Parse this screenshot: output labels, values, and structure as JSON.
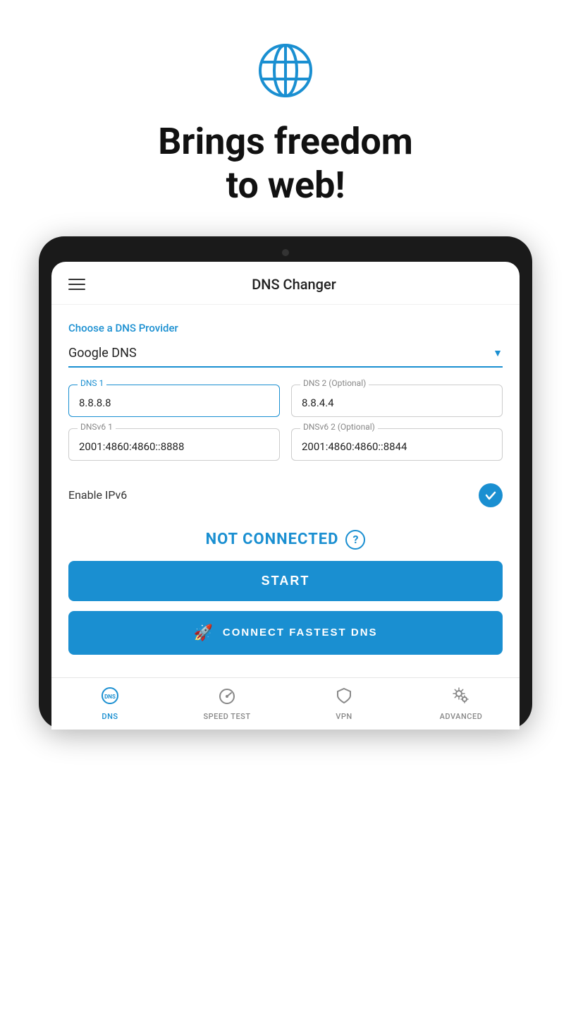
{
  "hero": {
    "title_line1": "Brings freedom",
    "title_line2": "to web!",
    "globe_icon": "globe-icon"
  },
  "app": {
    "header": {
      "title": "DNS Changer",
      "hamburger": "menu-icon"
    },
    "dns_provider": {
      "label": "Choose a DNS Provider",
      "selected": "Google DNS"
    },
    "dns_fields": [
      {
        "label": "DNS 1",
        "value": "8.8.8.8",
        "active": true
      },
      {
        "label": "DNS 2 (Optional)",
        "value": "8.8.4.4",
        "active": false
      },
      {
        "label": "DNSv6 1",
        "value": "2001:4860:4860::8888",
        "active": false
      },
      {
        "label": "DNSv6 2 (Optional)",
        "value": "2001:4860:4860::8844",
        "active": false
      }
    ],
    "ipv6": {
      "label": "Enable IPv6",
      "enabled": true
    },
    "status": {
      "text": "NOT CONNECTED",
      "help": "?"
    },
    "buttons": {
      "start": "START",
      "connect_fastest": "CONNECT FASTEST DNS"
    },
    "nav": [
      {
        "label": "DNS",
        "icon": "dns-icon",
        "active": true
      },
      {
        "label": "SPEED TEST",
        "icon": "speedtest-icon",
        "active": false
      },
      {
        "label": "VPN",
        "icon": "vpn-icon",
        "active": false
      },
      {
        "label": "ADVANCED",
        "icon": "advanced-icon",
        "active": false
      }
    ]
  }
}
